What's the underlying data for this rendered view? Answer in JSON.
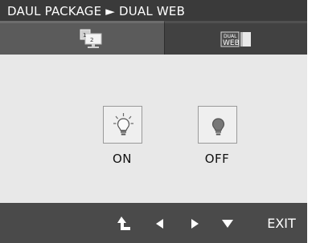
{
  "title": "DAUL PACKAGE ► DUAL WEB",
  "tabs": [
    {
      "icon": "dual-monitor-icon",
      "active": true
    },
    {
      "icon": "dual-web-icon",
      "active": false,
      "icon_text_top": "DUAL",
      "icon_text_bottom": "WEB"
    }
  ],
  "options": [
    {
      "label": "ON",
      "icon": "lightbulb-on-icon"
    },
    {
      "label": "OFF",
      "icon": "lightbulb-off-icon"
    }
  ],
  "bottom_bar": {
    "exit_label": "EXIT",
    "icons": [
      "return-up-icon",
      "arrow-left-icon",
      "arrow-right-icon",
      "arrow-down-icon"
    ]
  },
  "colors": {
    "background": "#4a4a4a",
    "title_bar": "#3a3a3a",
    "active_tab": "#5b5b5b",
    "content_panel": "#e8e8e8",
    "text_light": "#ffffff"
  }
}
